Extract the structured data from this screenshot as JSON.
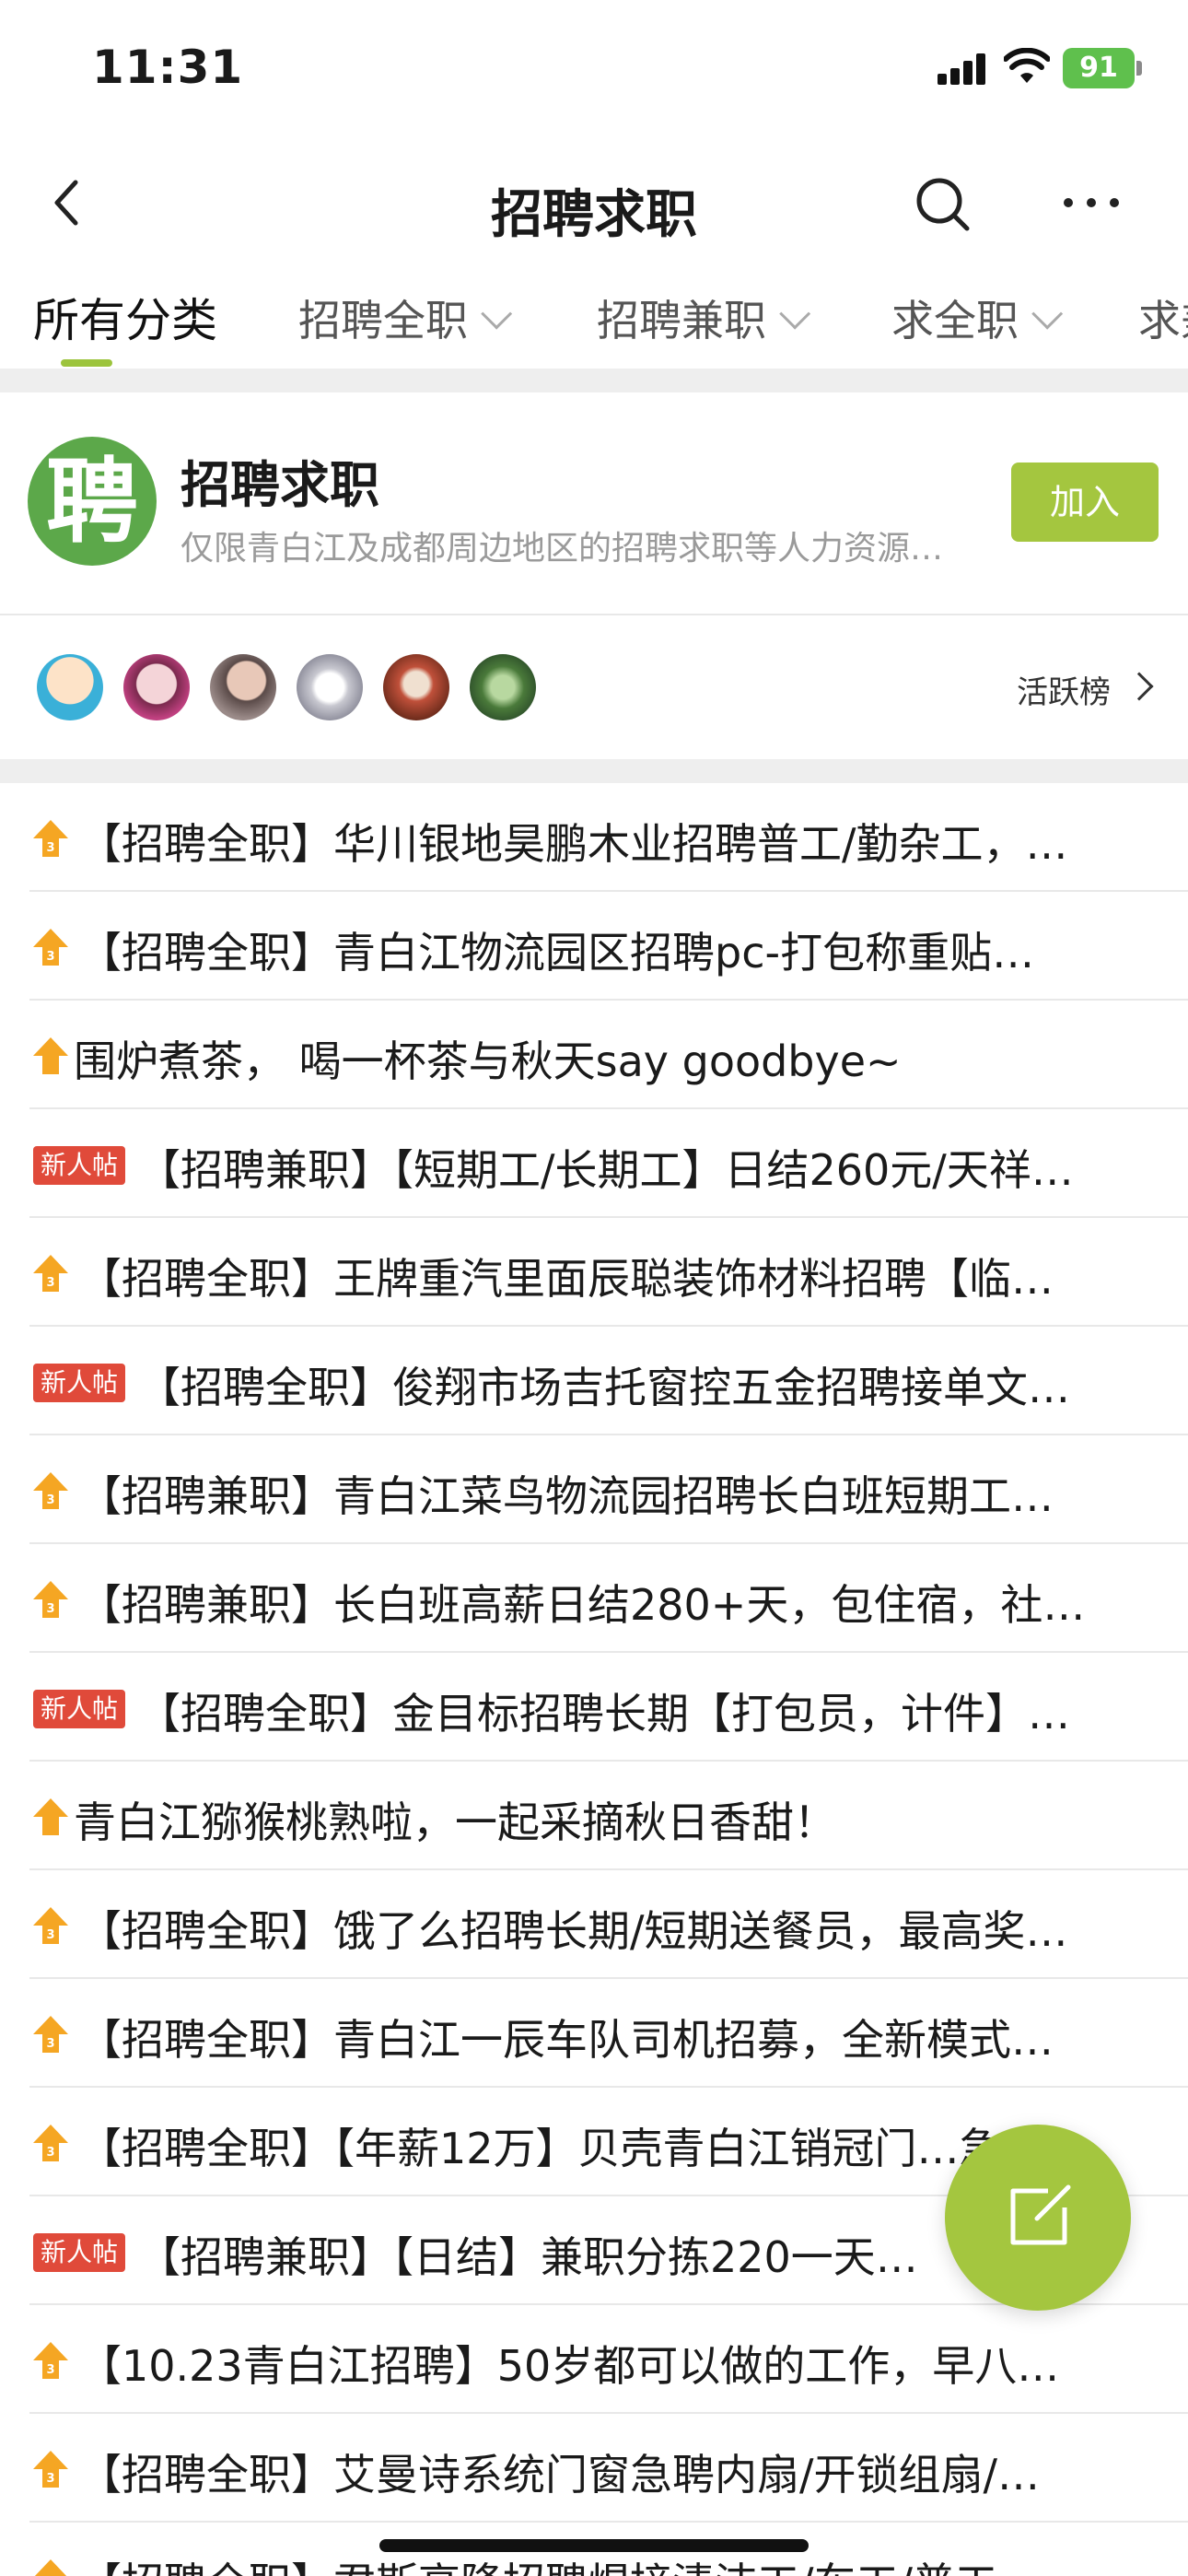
{
  "status_bar": {
    "time": "11:31",
    "battery": "91"
  },
  "nav": {
    "title": "招聘求职"
  },
  "tabs": [
    {
      "label": "所有分类"
    },
    {
      "label": "招聘全职"
    },
    {
      "label": "招聘兼职"
    },
    {
      "label": "求全职"
    },
    {
      "label": "求兼"
    }
  ],
  "group": {
    "logo_char": "聘",
    "name": "招聘求职",
    "description": "仅限青白江及成都周边地区的招聘求职等人力资源…",
    "join_label": "加入"
  },
  "members": {
    "active_rank_label": "活跃榜"
  },
  "posts": [
    {
      "badge": "up",
      "title": "【招聘全职】华川银地昊鹏木业招聘普工/勤杂工，…"
    },
    {
      "badge": "up",
      "title": "【招聘全职】青白江物流园区招聘pc-打包称重贴…"
    },
    {
      "badge": "up",
      "title": "围炉煮茶， 喝一杯茶与秋天say goodbye~"
    },
    {
      "badge": "new",
      "title": "【招聘兼职】【短期工/长期工】日结260元/天祥…"
    },
    {
      "badge": "up",
      "title": "【招聘全职】王牌重汽里面辰聪装饰材料招聘【临…"
    },
    {
      "badge": "new",
      "title": "【招聘全职】俊翔市场吉托窗控五金招聘接单文…"
    },
    {
      "badge": "up",
      "title": "【招聘兼职】青白江菜鸟物流园招聘长白班短期工…"
    },
    {
      "badge": "up",
      "title": "【招聘兼职】长白班高薪日结280+天，包住宿，社…"
    },
    {
      "badge": "new",
      "title": "【招聘全职】金目标招聘长期【打包员，计件】…"
    },
    {
      "badge": "up",
      "title": "青白江猕猴桃熟啦，一起采摘秋日香甜！"
    },
    {
      "badge": "up",
      "title": "【招聘全职】饿了么招聘长期/短期送餐员，最高奖…"
    },
    {
      "badge": "up",
      "title": "【招聘全职】青白江一辰车队司机招募，全新模式…"
    },
    {
      "badge": "up",
      "title": "【招聘全职】【年薪12万】贝壳青白江销冠门…急…"
    },
    {
      "badge": "new",
      "title": "【招聘兼职】【日结】兼职分拣220一天…"
    },
    {
      "badge": "up",
      "title": "【10.23青白江招聘】50岁都可以做的工作，早八…"
    },
    {
      "badge": "up",
      "title": "【招聘全职】艾曼诗系统门窗急聘内扇/开锁组扇/…"
    },
    {
      "badge": "up",
      "title": "【招聘全职】君斯高隆招聘焊接清洁工/车工/普工…"
    }
  ],
  "badges": {
    "new_label": "新人帖",
    "up_level": "3"
  },
  "colors": {
    "accent": "#a4c63f",
    "new_badge": "#e04a3a",
    "up_icon": "#f5a623"
  }
}
